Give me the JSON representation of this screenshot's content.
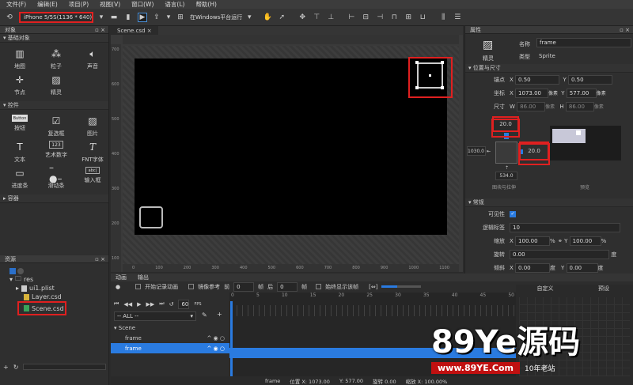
{
  "menu": [
    "文件(F)",
    "编辑(E)",
    "项目(P)",
    "视图(V)",
    "窗口(W)",
    "语言(L)",
    "帮助(H)"
  ],
  "toolbar": {
    "device": "iPhone 5/5S(1136 * 640)",
    "run_label": "在Windows平台运行"
  },
  "objects_panel": {
    "title": "对象",
    "basic_section": "基础对象",
    "basic_items": [
      "地图",
      "粒子",
      "声音",
      "节点",
      "精灵"
    ],
    "control_section": "控件",
    "control_items": [
      "按钮",
      "复选框",
      "图片",
      "文本",
      "艺术数字",
      "FNT字体",
      "进度条",
      "滑动条",
      "输入框"
    ],
    "container_section": "容器",
    "button_glyph_text": "Button",
    "artnum_glyph_text": "123",
    "input_glyph_text": "abc|"
  },
  "resources_panel": {
    "title": "资源",
    "tree": [
      "res",
      "ui1.plist",
      "Layer.csd",
      "Scene.csd"
    ]
  },
  "editor": {
    "tab": "Scene.csd",
    "ruler_top": [
      "0",
      "100",
      "200",
      "300",
      "400",
      "500",
      "600",
      "700",
      "800",
      "900",
      "1000",
      "1100"
    ],
    "ruler_left": [
      "700",
      "600",
      "500",
      "400",
      "300",
      "200",
      "100"
    ]
  },
  "properties": {
    "title": "属性",
    "name_label": "名称",
    "name_value": "frame",
    "type_label": "类型",
    "type_value": "Sprite",
    "sprite_label": "精灵",
    "pos_section": "位置与尺寸",
    "anchor_label": "锚点",
    "anchor_x": "0.50",
    "anchor_y": "0.50",
    "pos_label": "坐标",
    "pos_x": "1073.00",
    "pos_y": "577.00",
    "pos_unit": "像素",
    "size_label": "尺寸",
    "size_w": "86.00",
    "size_h": "86.00",
    "size_unit": "像素",
    "margin_top": "20.0",
    "margin_right": "20.0",
    "margin_left": "1030.0",
    "margin_bottom": "534.0",
    "layout_caption": "图块与拉伸",
    "preview_caption": "预览",
    "general_section": "常规",
    "visible_label": "可见性",
    "tag_label": "逻辑标签",
    "tag_value": "10",
    "scale_label": "缩放",
    "scale_x": "100.00",
    "scale_y": "100.00",
    "percent": "%",
    "rotate_label": "旋转",
    "rotate_value": "0.00",
    "degree": "度",
    "skew_label": "倾斜",
    "skew_x": "0.00",
    "skew_y": "0.00",
    "x": "X",
    "y": "Y",
    "w": "W",
    "h": "H"
  },
  "timeline": {
    "tab_anim": "动画",
    "tab_output": "输出",
    "record_label": "开始记录动画",
    "onion_label": "镜像参考",
    "before_label": "前",
    "before_val": "0",
    "frame_unit": "帧",
    "after_label": "后",
    "after_val": "0",
    "always_label": "始终显示该帧",
    "fps": "60",
    "fps_unit": "FPS",
    "all": "-- ALL --",
    "custom_label": "自定义",
    "preset_label": "预设",
    "ticks": [
      "0",
      "5",
      "10",
      "15",
      "20",
      "25",
      "30",
      "35",
      "40",
      "45",
      "50"
    ],
    "layers": [
      "Scene",
      "frame",
      "frame"
    ]
  },
  "statusbar": {
    "name": "frame",
    "pos": "位置 X: 1073.00",
    "posy": "Y: 577.00",
    "rotate": "旋转 0.00",
    "scale": "缩放 X: 100.00%"
  },
  "watermark": {
    "main": "89Ye源码",
    "url": "www.89YE.Com",
    "tag": "10年老站"
  }
}
